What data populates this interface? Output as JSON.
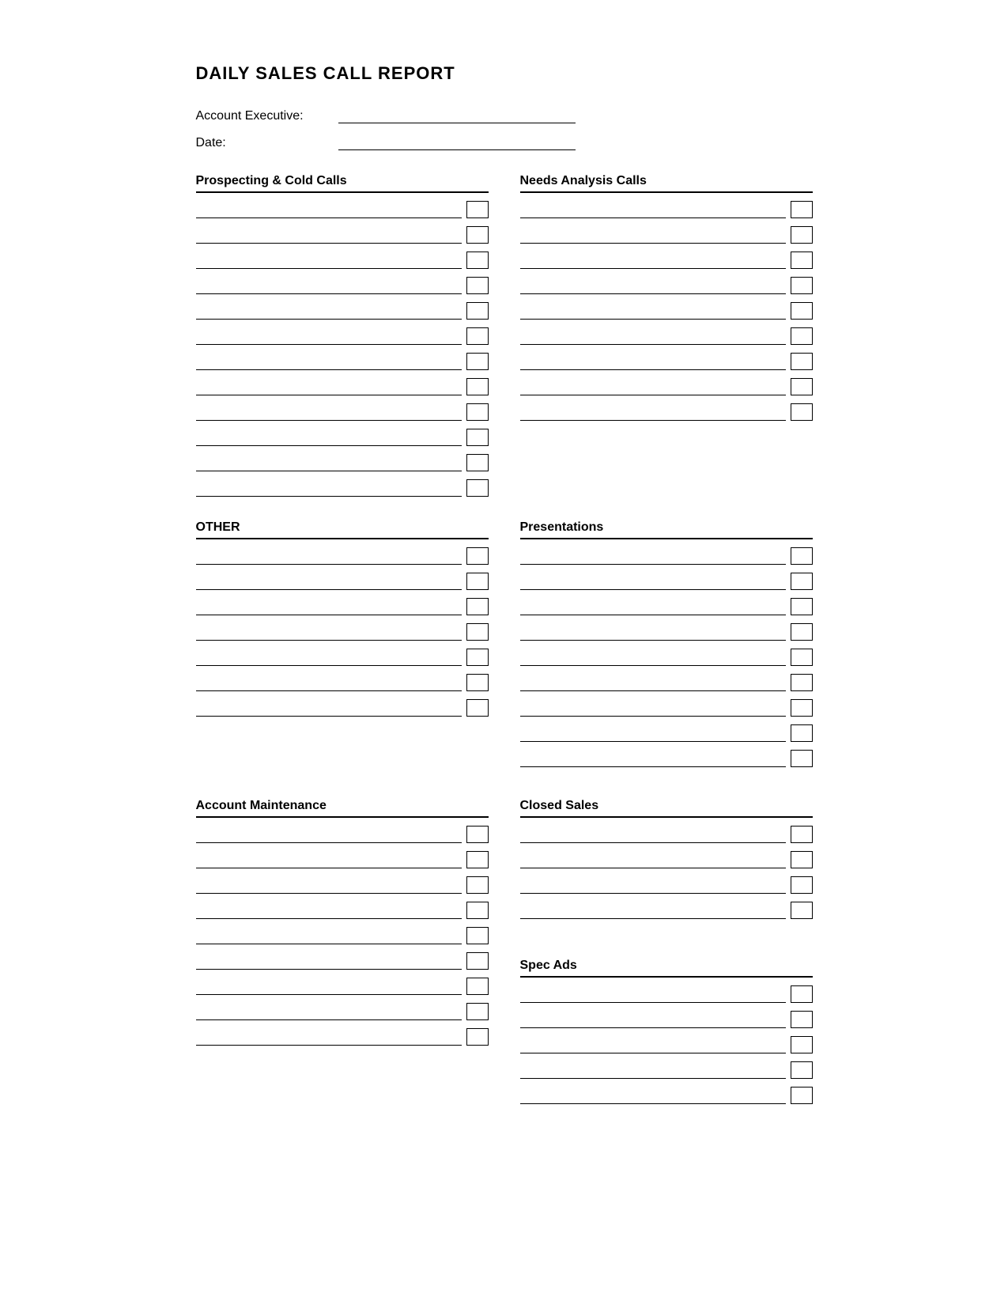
{
  "title": "DAILY SALES CALL REPORT",
  "header": {
    "account_executive_label": "Account Executive:",
    "date_label": "Date:"
  },
  "sections": {
    "prospecting": {
      "title": "Prospecting & Cold Calls",
      "rows": 12
    },
    "needs_analysis": {
      "title": "Needs Analysis Calls",
      "rows": 9
    },
    "other": {
      "title": "OTHER",
      "rows": 7
    },
    "presentations": {
      "title": "Presentations",
      "rows": 9
    },
    "account_maintenance": {
      "title": "Account Maintenance",
      "rows": 9
    },
    "closed_sales": {
      "title": "Closed Sales",
      "rows": 4
    },
    "spec_ads": {
      "title": "Spec Ads",
      "rows": 5
    }
  }
}
